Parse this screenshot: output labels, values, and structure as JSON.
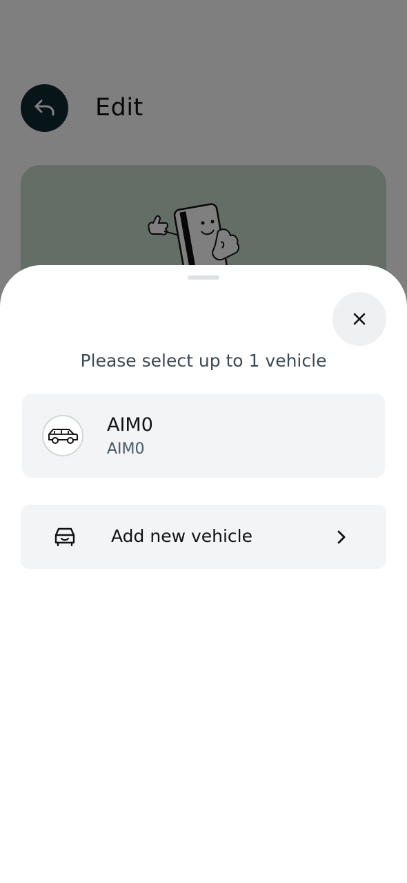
{
  "header": {
    "title": "Edit",
    "back_icon": "undo-arrow-icon"
  },
  "hero": {
    "illustration": "card-mascot-thumbs-up-illustration"
  },
  "sheet": {
    "title": "Please select up to 1 vehicle",
    "close_icon": "close-icon"
  },
  "vehicles": [
    {
      "name": "AIM0",
      "plate": "AIM0",
      "icon": "car-icon"
    }
  ],
  "add_vehicle": {
    "label": "Add new vehicle",
    "icon": "car-front-icon",
    "chevron_icon": "chevron-right-icon"
  },
  "colors": {
    "back_button_bg": "#0f2a33",
    "hero_bg": "#c5dccd",
    "card_bg": "#f3f4f6"
  }
}
